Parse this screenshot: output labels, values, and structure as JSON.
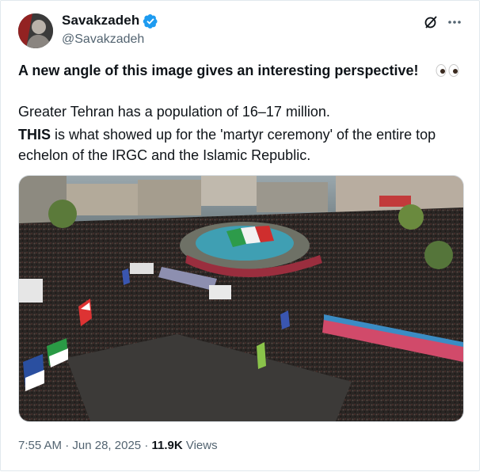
{
  "author": {
    "name": "Savakzadeh",
    "handle": "@Savakzadeh",
    "verified": true
  },
  "tweet": {
    "headline": "A new angle of this image gives an interesting perspective!",
    "headline_emoji": "eyes-emoji",
    "para1": "Greater Tehran has a population of 16–17 million.",
    "para2_bold": "THIS",
    "para2_rest": " is what showed up for the 'martyr ceremony' of the entire top echelon of the IRGC and the Islamic Republic."
  },
  "meta": {
    "time": "7:55 AM",
    "separator": "·",
    "date": "Jun 28, 2025",
    "views_count": "11.9K",
    "views_label": "Views"
  },
  "icons": {
    "verified": "verified-badge-icon",
    "grok": "grok-icon",
    "more": "more-icon"
  },
  "colors": {
    "verified_blue": "#1d9bf0",
    "secondary_text": "#536471",
    "primary_text": "#0f1419"
  }
}
